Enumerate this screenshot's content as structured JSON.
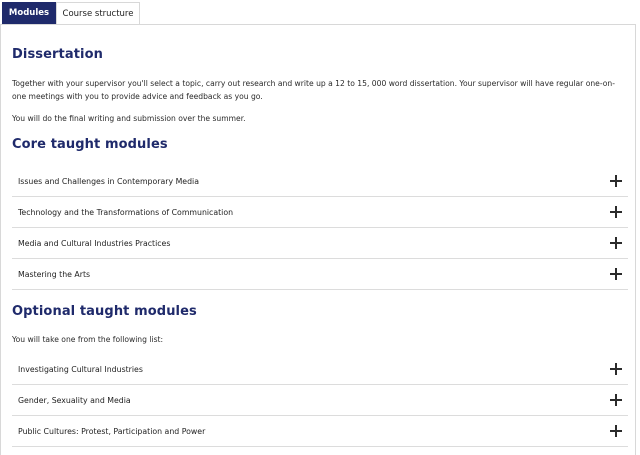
{
  "tabs": [
    {
      "label": "Modules",
      "active": true
    },
    {
      "label": "Course structure",
      "active": false
    }
  ],
  "dissertation": {
    "title": "Dissertation",
    "paragraphs": [
      "Together with your supervisor you'll select a topic, carry out research and write up a 12 to 15, 000 word dissertation. Your supervisor will have regular one-on-one meetings with you to provide advice and feedback as you go.",
      "You will do the final writing and submission over the summer."
    ]
  },
  "core": {
    "title": "Core taught modules",
    "items": [
      {
        "label": "Issues and Challenges in Contemporary Media"
      },
      {
        "label": "Technology and the Transformations of Communication"
      },
      {
        "label": "Media and Cultural Industries Practices"
      },
      {
        "label": "Mastering the Arts"
      }
    ]
  },
  "optional": {
    "title": "Optional taught modules",
    "intro": "You will take one from the following list:",
    "items": [
      {
        "label": "Investigating Cultural Industries"
      },
      {
        "label": "Gender, Sexuality and Media"
      },
      {
        "label": "Public Cultures: Protest, Participation and Power"
      }
    ]
  },
  "colors": {
    "accent": "#1f2a6b",
    "divider": "#dcdcdc"
  },
  "icons": {
    "expand": "plus-icon"
  }
}
